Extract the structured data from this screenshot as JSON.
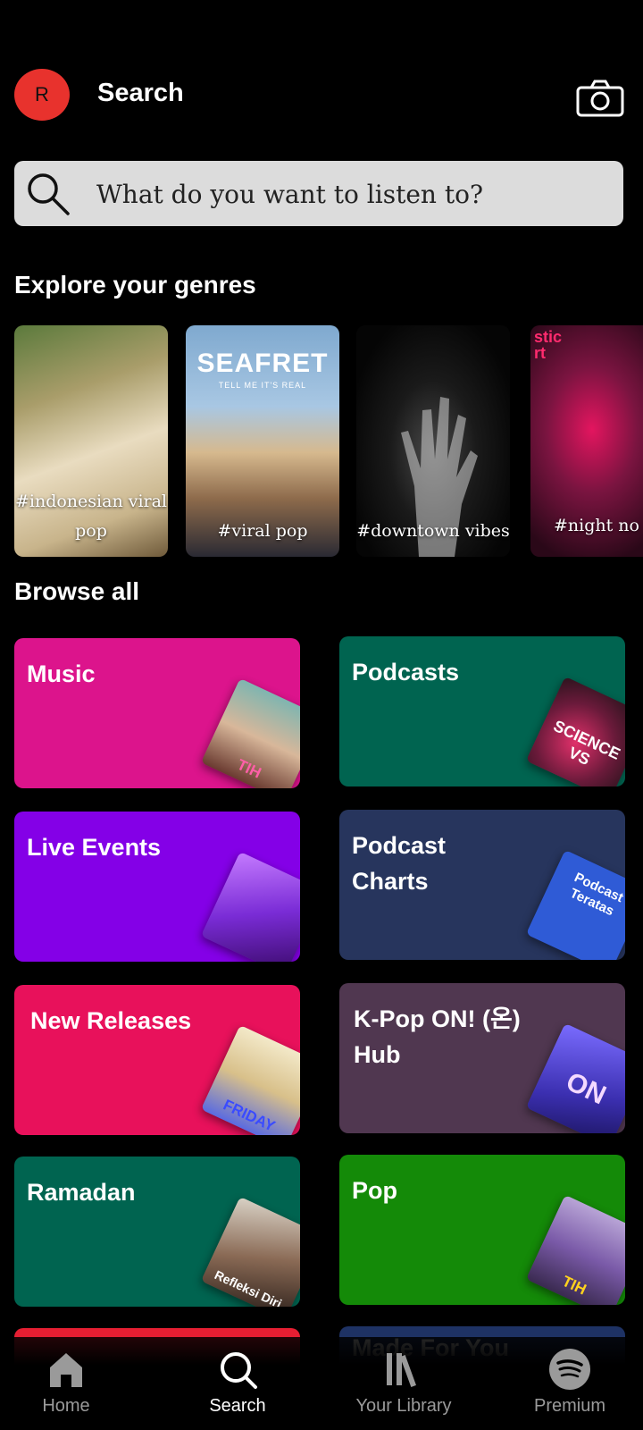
{
  "header": {
    "avatar_initial": "R",
    "title": "Search",
    "camera_icon": "camera-icon"
  },
  "search": {
    "placeholder": "What do you want to listen to?",
    "value": ""
  },
  "genres_section": {
    "title": "Explore your genres",
    "items": [
      {
        "label": "#indonesian viral pop"
      },
      {
        "label": "#viral pop",
        "art_title": "SEAFRET",
        "art_subtitle": "TELL ME IT'S REAL"
      },
      {
        "label": "#downtown vibes"
      },
      {
        "label": "#night no"
      }
    ]
  },
  "browse_section": {
    "title": "Browse all",
    "tiles": [
      {
        "label": "Music",
        "color": "#dc148c",
        "art_text": "TIH"
      },
      {
        "label": "Podcasts",
        "color": "#006450",
        "art_text": "SCIENCE VS"
      },
      {
        "label": "Live Events",
        "color": "#8400e7",
        "art_text": ""
      },
      {
        "label": "Podcast Charts",
        "color": "#27355d",
        "art_text": "Podcast Teratas"
      },
      {
        "label": "New Releases",
        "color": "#e8115b",
        "art_text": "FRIDAY"
      },
      {
        "label": "K-Pop ON! (온) Hub",
        "color": "#503750",
        "art_text": "ON"
      },
      {
        "label": "Ramadan",
        "color": "#006450",
        "art_text": "Refleksi Diri"
      },
      {
        "label": "Pop",
        "color": "#148a08",
        "art_text": "TIH"
      },
      {
        "label": "",
        "color": "#e61e32",
        "art_text": ""
      },
      {
        "label": "Made For You",
        "color": "#1e3264",
        "art_text": ""
      }
    ]
  },
  "bottom_nav": {
    "items": [
      {
        "label": "Home",
        "icon": "home-icon"
      },
      {
        "label": "Search",
        "icon": "search-icon",
        "active": true
      },
      {
        "label": "Your Library",
        "icon": "library-icon"
      },
      {
        "label": "Premium",
        "icon": "spotify-icon"
      }
    ]
  }
}
